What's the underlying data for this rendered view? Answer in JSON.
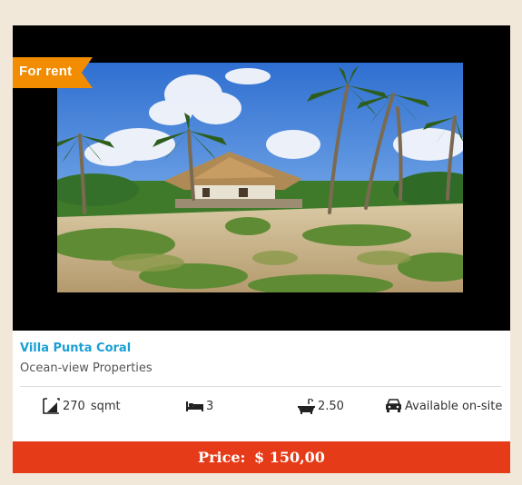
{
  "listing": {
    "status_badge": "For rent",
    "title": "Villa Punta Coral",
    "category": "Ocean-view Properties",
    "features": {
      "area_value": "270",
      "area_unit": "sqmt",
      "bedrooms": "3",
      "bathrooms": "2.50",
      "parking": "Available on-site"
    },
    "price_label": "Price:",
    "price_value": "$ 150,00"
  },
  "icons": {
    "area": "area-icon",
    "bed": "bed-icon",
    "bath": "bathtub-icon",
    "parking": "car-icon"
  },
  "colors": {
    "badge": "#f28c00",
    "title_link": "#1a9fd6",
    "price_bar": "#e63b18",
    "page_background": "#f2e8d9"
  }
}
